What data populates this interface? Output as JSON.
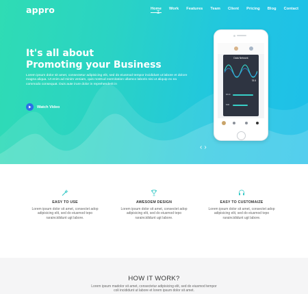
{
  "brand": {
    "logo": "appro"
  },
  "nav": {
    "items": [
      {
        "label": "Home",
        "active": true
      },
      {
        "label": "Work"
      },
      {
        "label": "Features"
      },
      {
        "label": "Team"
      },
      {
        "label": "Client"
      },
      {
        "label": "Pricing"
      },
      {
        "label": "Blog"
      },
      {
        "label": "Contact"
      }
    ]
  },
  "hero": {
    "title_line1": "It's all about",
    "title_line2": "Promoting your Business",
    "description": "Lorem ipsum dolor sit amet, consectetur adipisicing elit, sed do eiusmod tempor incididunt ut labore et dolore magna aliqua. Ut enim ad minim veniam, quis nostrud exercitation ullamco laboris nisi ut aliquip ex ea commodo consequat. Duis aute irure dolor in reprehenderit in",
    "watch_label": "Watch Video",
    "slider_prev": "‹",
    "slider_next": "›",
    "colors": {
      "gradient_start": "#2fdcb4",
      "gradient_end": "#1ebfe9",
      "play_button": "#2c6fe7"
    }
  },
  "phone": {
    "screen_title": "Data Network",
    "screen_value": "78.5",
    "labels": [
      "68.4C",
      "84M"
    ]
  },
  "features": [
    {
      "icon": "magic-wand-icon",
      "title": "EASY TO USE",
      "text": "Lorem ipsum dolor sit amet, consectet adop adipisicing elit, sed do eiusmod tepo raraincididunt ugt labore."
    },
    {
      "icon": "trophy-icon",
      "title": "AWESOEM DESIGN",
      "text": "Lorem ipsum dolor sit amet, consectet adop adipisicing elit, sed do eiusmod tepo raraincididunt ugt labore."
    },
    {
      "icon": "headset-icon",
      "title": "EASY TO CUSTOMAIZE",
      "text": "Lorem ipsum dolor sit amet, consectet adop adipisicing elit, sed do eiusmod tepo raraincididunt ugt labore."
    }
  ],
  "how": {
    "title": "HOW IT WORK?",
    "text": "Lorem ipsum madolor sit amet, consectetur adipisicing elit, sed do eiusmod tempor coli incididunt ut labore et lorem ipsum dolor sit amet."
  }
}
